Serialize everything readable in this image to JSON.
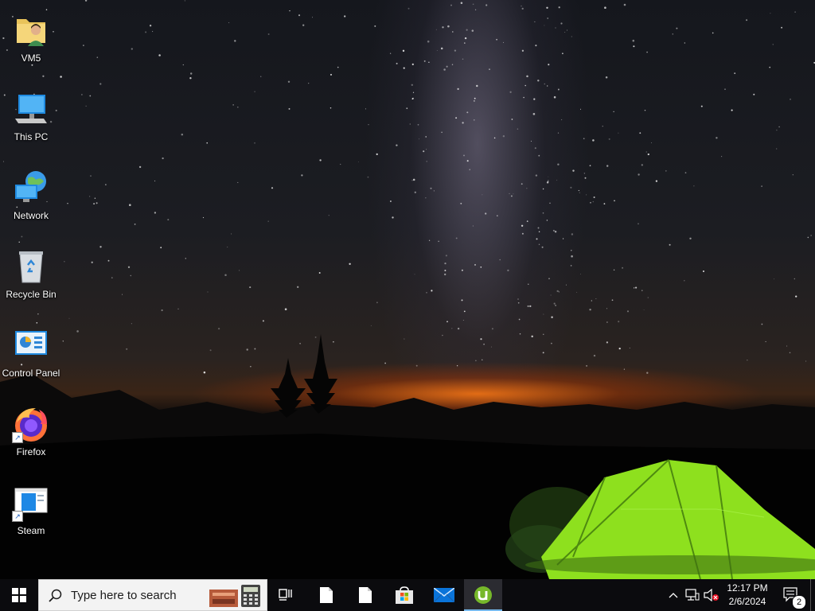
{
  "desktop": {
    "icons": [
      {
        "label": "VM5",
        "icon": "user-folder-icon"
      },
      {
        "label": "This PC",
        "icon": "computer-icon"
      },
      {
        "label": "Network",
        "icon": "network-icon"
      },
      {
        "label": "Recycle Bin",
        "icon": "recycle-bin-icon"
      },
      {
        "label": "Control Panel",
        "icon": "control-panel-icon"
      },
      {
        "label": "Firefox",
        "icon": "firefox-icon"
      },
      {
        "label": "Steam",
        "icon": "steam-icon"
      }
    ]
  },
  "taskbar": {
    "search_placeholder": "Type here to search",
    "pinned": [
      {
        "icon": "start-windows-icon"
      },
      {
        "icon": "task-view-icon"
      },
      {
        "icon": "file-icon"
      },
      {
        "icon": "file-icon"
      },
      {
        "icon": "microsoft-store-icon"
      },
      {
        "icon": "mail-icon"
      },
      {
        "icon": "utorrent-icon",
        "active": true
      }
    ],
    "tray": {
      "time": "12:17 PM",
      "date": "2/6/2024",
      "notification_count": "2"
    }
  },
  "colors": {
    "taskbar_bg": "#0b0b0e",
    "accent": "#76b9ed",
    "tent_green": "#8ee01e"
  }
}
